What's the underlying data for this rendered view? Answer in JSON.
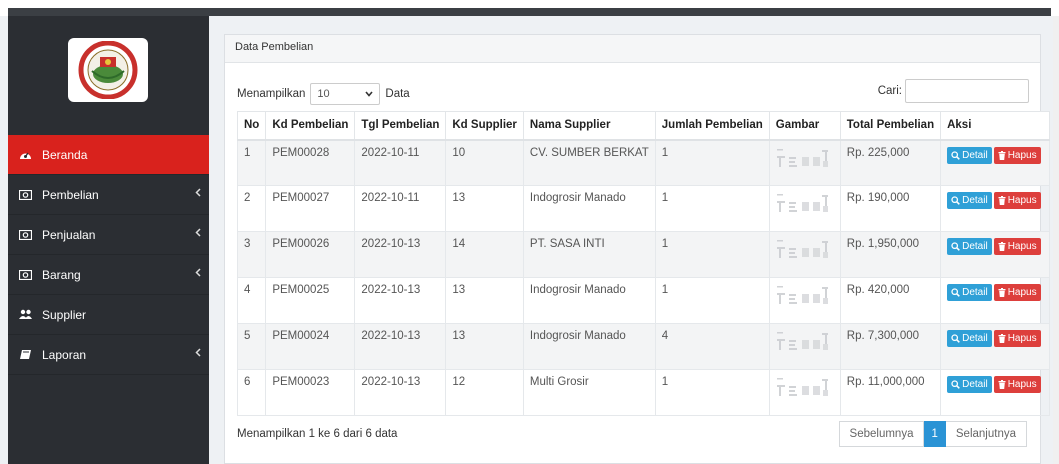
{
  "sidebar": {
    "items": [
      {
        "label": "Beranda",
        "icon": "dashboard-icon",
        "active": true,
        "has_submenu": false
      },
      {
        "label": "Pembelian",
        "icon": "money-icon",
        "active": false,
        "has_submenu": true
      },
      {
        "label": "Penjualan",
        "icon": "money-icon",
        "active": false,
        "has_submenu": true
      },
      {
        "label": "Barang",
        "icon": "money-icon",
        "active": false,
        "has_submenu": true
      },
      {
        "label": "Supplier",
        "icon": "users-icon",
        "active": false,
        "has_submenu": false
      },
      {
        "label": "Laporan",
        "icon": "book-icon",
        "active": false,
        "has_submenu": true
      }
    ]
  },
  "panel": {
    "title": "Data Pembelian"
  },
  "controls": {
    "show_prefix": "Menampilkan",
    "show_value": "10",
    "show_suffix": "Data",
    "search_label": "Cari:",
    "search_value": ""
  },
  "table": {
    "headers": [
      "No",
      "Kd Pembelian",
      "Tgl Pembelian",
      "Kd Supplier",
      "Nama Supplier",
      "Jumlah Pembelian",
      "Gambar",
      "Total Pembelian",
      "Aksi"
    ],
    "rows": [
      {
        "no": "1",
        "kd": "PEM00028",
        "tgl": "2022-10-11",
        "kd_supplier": "10",
        "nama": "CV. SUMBER BERKAT",
        "jumlah": "1",
        "total": "Rp. 225,000"
      },
      {
        "no": "2",
        "kd": "PEM00027",
        "tgl": "2022-10-11",
        "kd_supplier": "13",
        "nama": "Indogrosir Manado",
        "jumlah": "1",
        "total": "Rp. 190,000"
      },
      {
        "no": "3",
        "kd": "PEM00026",
        "tgl": "2022-10-13",
        "kd_supplier": "14",
        "nama": "PT. SASA INTI",
        "jumlah": "1",
        "total": "Rp. 1,950,000"
      },
      {
        "no": "4",
        "kd": "PEM00025",
        "tgl": "2022-10-13",
        "kd_supplier": "13",
        "nama": "Indogrosir Manado",
        "jumlah": "1",
        "total": "Rp. 420,000"
      },
      {
        "no": "5",
        "kd": "PEM00024",
        "tgl": "2022-10-13",
        "kd_supplier": "13",
        "nama": "Indogrosir Manado",
        "jumlah": "4",
        "total": "Rp. 7,300,000"
      },
      {
        "no": "6",
        "kd": "PEM00023",
        "tgl": "2022-10-13",
        "kd_supplier": "12",
        "nama": "Multi Grosir",
        "jumlah": "1",
        "total": "Rp. 11,000,000"
      }
    ],
    "detail_label": "Detail",
    "hapus_label": "Hapus"
  },
  "footer": {
    "info": "Menampilkan 1 ke 6 dari 6 data",
    "prev": "Sebelumnya",
    "current": "1",
    "next": "Selanjutnya"
  },
  "colors": {
    "sidebar_bg": "#2b2e33",
    "active_menu": "#d9221d",
    "detail_btn": "#2fa0d7",
    "hapus_btn": "#dd3f3c",
    "pager_active": "#2a93d5"
  }
}
